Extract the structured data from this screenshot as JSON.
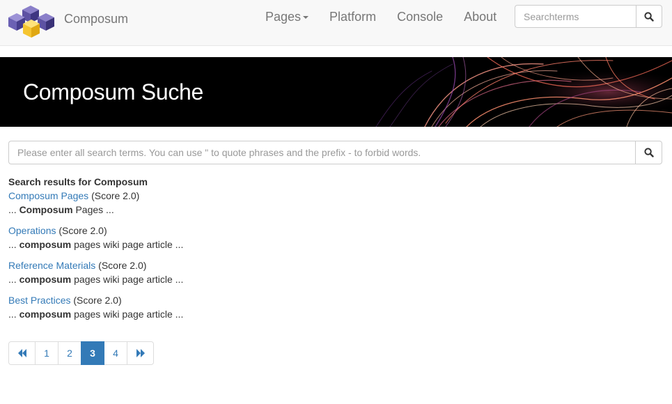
{
  "navbar": {
    "brand_name": "Composum",
    "links": [
      {
        "label": "Pages",
        "has_dropdown": true
      },
      {
        "label": "Platform"
      },
      {
        "label": "Console"
      },
      {
        "label": "About"
      }
    ],
    "search_placeholder": "Searchterms"
  },
  "banner": {
    "title": "Composum Suche"
  },
  "search": {
    "placeholder": "Please enter all search terms. You can use \" to quote phrases and the prefix - to forbid words."
  },
  "results": {
    "heading": "Search results for Composum",
    "items": [
      {
        "title": "Composum Pages",
        "score": "(Score 2.0)",
        "snippet_pre": "... ",
        "snippet_bold": "Composum",
        "snippet_post": " Pages ..."
      },
      {
        "title": "Operations",
        "score": "(Score 2.0)",
        "snippet_pre": "... ",
        "snippet_bold": "composum",
        "snippet_post": " pages wiki page article ..."
      },
      {
        "title": "Reference Materials",
        "score": "(Score 2.0)",
        "snippet_pre": "... ",
        "snippet_bold": "composum",
        "snippet_post": " pages wiki page article ..."
      },
      {
        "title": "Best Practices",
        "score": "(Score 2.0)",
        "snippet_pre": "... ",
        "snippet_bold": "composum",
        "snippet_post": " pages wiki page article ..."
      }
    ]
  },
  "pagination": {
    "pages": [
      "1",
      "2",
      "3",
      "4"
    ],
    "current": "3",
    "first_icon": "double-chevron-left-icon",
    "last_icon": "double-chevron-right-icon"
  },
  "colors": {
    "link": "#337ab7",
    "active_page": "#337ab7",
    "navbar_bg": "#f8f8f8"
  }
}
